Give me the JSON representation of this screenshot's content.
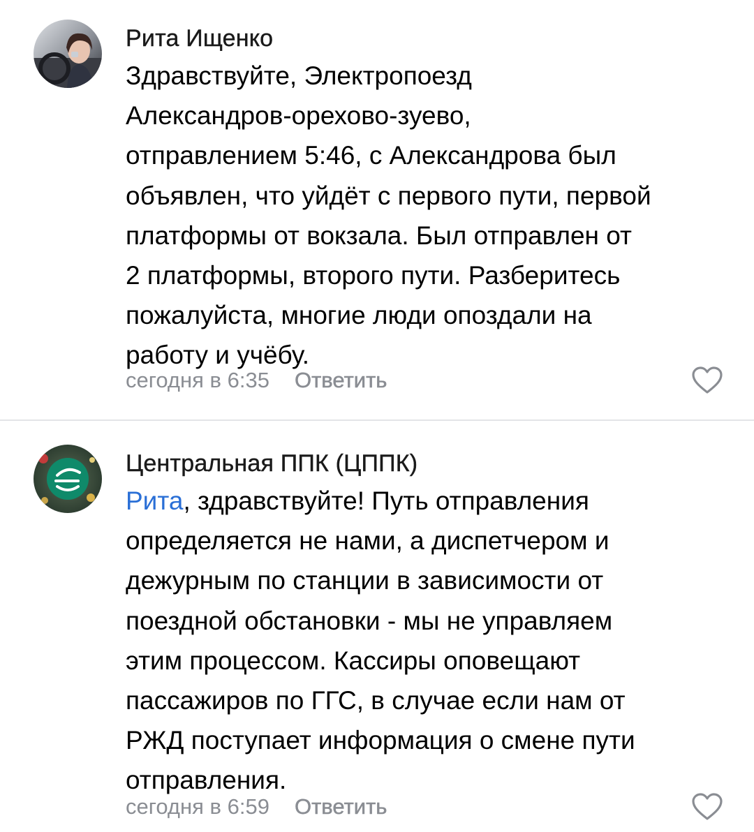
{
  "comments": [
    {
      "author": "Рита Ищенко",
      "lines": [
        "Здравствуйте, Электропоезд",
        "Александров-орехово-зуево,",
        "отправлением 5:46, с Александрова был",
        "объявлен, что уйдёт с первого пути, первой",
        "платформы от вокзала. Был отправлен от",
        "2 платформы, второго пути. Разберитесь",
        "пожалуйста, многие люди опоздали на",
        "работу и учёбу."
      ],
      "time": "сегодня в 6:35",
      "reply_label": "Ответить",
      "avatar_icon": "user-photo-avatar",
      "like_icon": "heart-outline-icon"
    },
    {
      "author": "Центральная ППК (ЦППК)",
      "mention": "Рита",
      "first_line_rest": ", здравствуйте! Путь отправления",
      "lines": [
        "определяется не нами, а диспетчером и",
        "дежурным по станции в зависимости от",
        "поездной обстановки - мы не управляем",
        "этим процессом. Кассиры оповещают",
        "пассажиров по ГГС, в случае если нам от",
        "РЖД поступает информация о смене пути",
        "отправления."
      ],
      "time": "сегодня в 6:59",
      "reply_label": "Ответить",
      "avatar_icon": "company-logo-avatar",
      "like_icon": "heart-outline-icon"
    }
  ],
  "colors": {
    "mention": "#2a6fd6",
    "meta": "#8a8d93",
    "divider": "#e3e4e7",
    "logo_green": "#0f8a6a"
  }
}
